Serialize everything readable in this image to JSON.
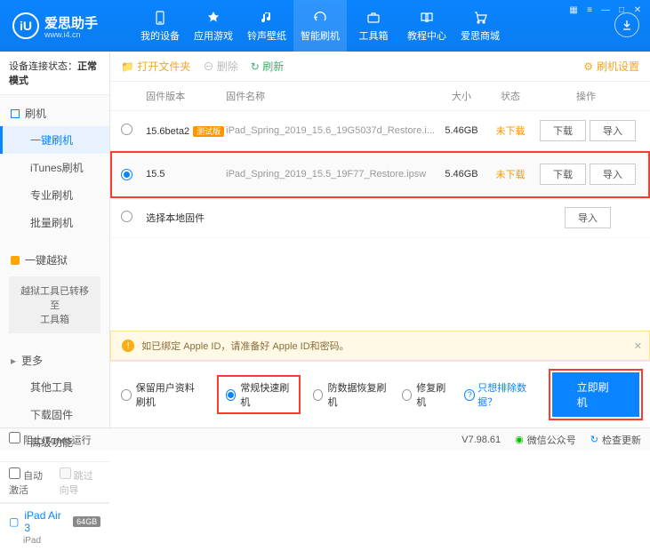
{
  "app": {
    "name": "爱思助手",
    "url": "www.i4.cn"
  },
  "nav": {
    "items": [
      {
        "label": "我的设备"
      },
      {
        "label": "应用游戏"
      },
      {
        "label": "铃声壁纸"
      },
      {
        "label": "智能刷机"
      },
      {
        "label": "工具箱"
      },
      {
        "label": "教程中心"
      },
      {
        "label": "爱思商城"
      }
    ]
  },
  "sidebar": {
    "status_label": "设备连接状态：",
    "status_value": "正常模式",
    "flash_head": "刷机",
    "flash_items": [
      "一键刷机",
      "iTunes刷机",
      "专业刷机",
      "批量刷机"
    ],
    "jailbreak_head": "一键越狱",
    "jailbreak_info": "越狱工具已转移至\n工具箱",
    "more_head": "更多",
    "more_items": [
      "其他工具",
      "下载固件",
      "高级功能"
    ],
    "auto_activate": "自动激活",
    "skip_guide": "跳过向导",
    "device_name": "iPad Air 3",
    "device_storage": "64GB",
    "device_sub": "iPad"
  },
  "toolbar": {
    "open": "打开文件夹",
    "delete": "删除",
    "refresh": "刷新",
    "settings": "刷机设置"
  },
  "table": {
    "headers": {
      "version": "固件版本",
      "name": "固件名称",
      "size": "大小",
      "state": "状态",
      "ops": "操作"
    },
    "rows": [
      {
        "version": "15.6beta2",
        "beta": "测试版",
        "name": "iPad_Spring_2019_15.6_19G5037d_Restore.i...",
        "size": "5.46GB",
        "state": "未下载",
        "dl": "下载",
        "imp": "导入"
      },
      {
        "version": "15.5",
        "name": "iPad_Spring_2019_15.5_19F77_Restore.ipsw",
        "size": "5.46GB",
        "state": "未下载",
        "dl": "下载",
        "imp": "导入"
      }
    ],
    "local_row": {
      "label": "选择本地固件",
      "imp": "导入"
    }
  },
  "warning": "如已绑定 Apple ID，请准备好 Apple ID和密码。",
  "modes": {
    "keep": "保留用户资料刷机",
    "normal": "常规快速刷机",
    "recover": "防数据恢复刷机",
    "repair": "修复刷机",
    "exclude": "只想排除数据？",
    "flash": "立即刷机"
  },
  "statusbar": {
    "block_itunes": "阻止iTunes运行",
    "version": "V7.98.61",
    "wechat": "微信公众号",
    "update": "检查更新"
  }
}
